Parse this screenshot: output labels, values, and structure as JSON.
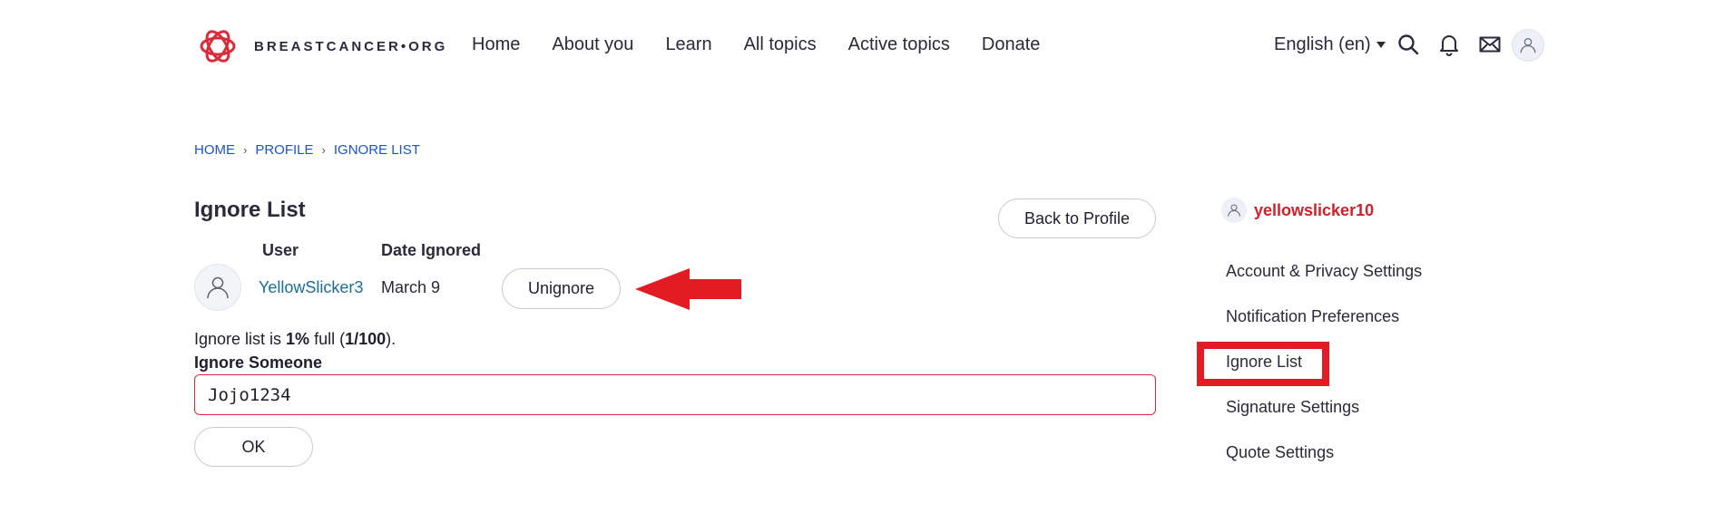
{
  "header": {
    "logo_text": "BREASTCANCER•ORG",
    "nav": [
      "Home",
      "About you",
      "Learn",
      "All topics",
      "Active topics",
      "Donate"
    ],
    "language": "English (en)",
    "icons": [
      "search-icon",
      "bell-icon",
      "mail-icon",
      "user-avatar-icon"
    ]
  },
  "breadcrumb": {
    "home": "HOME",
    "profile": "PROFILE",
    "current": "IGNORE LIST",
    "separator": "›"
  },
  "main": {
    "title": "Ignore List",
    "back_button": "Back to Profile",
    "table": {
      "headers": {
        "user": "User",
        "date": "Date Ignored"
      },
      "rows": [
        {
          "user": "YellowSlicker3",
          "date": "March 9",
          "action": "Unignore"
        }
      ]
    },
    "usage": {
      "prefix": "Ignore list is ",
      "percent": "1%",
      "middle": " full (",
      "count": "1/100",
      "suffix": ")."
    },
    "ignore_label": "Ignore Someone",
    "ignore_input_value": "Jojo1234",
    "ok_button": "OK"
  },
  "sidebar": {
    "username": "yellowslicker10",
    "links": [
      "Account & Privacy Settings",
      "Notification Preferences",
      "Ignore List",
      "Signature Settings",
      "Quote Settings"
    ]
  },
  "colors": {
    "brand_red": "#d0202e",
    "annotation_red": "#e31b23",
    "link_blue": "#1f54c7",
    "user_link_teal": "#1b6f96"
  }
}
